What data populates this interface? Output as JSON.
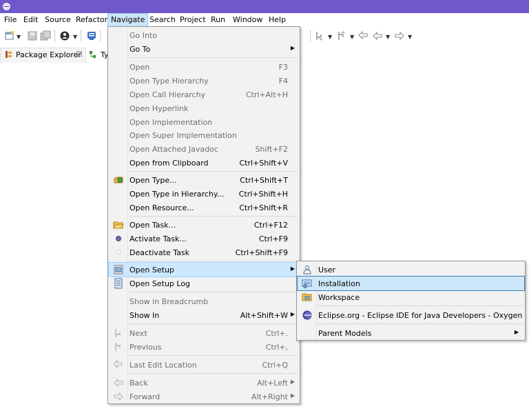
{
  "menubar": {
    "items": [
      "File",
      "Edit",
      "Source",
      "Refactor",
      "Navigate",
      "Search",
      "Project",
      "Run",
      "Window",
      "Help"
    ],
    "active": "Navigate"
  },
  "tabs": {
    "package_explorer": "Package Explorer",
    "close_glyph": "☒",
    "second_tab_partial": "Ty"
  },
  "navigate_menu": {
    "go_into": "Go Into",
    "go_to": "Go To",
    "open": {
      "label": "Open",
      "shortcut": "F3"
    },
    "open_type_hierarchy": {
      "label": "Open Type Hierarchy",
      "shortcut": "F4"
    },
    "open_call_hierarchy": {
      "label": "Open Call Hierarchy",
      "shortcut": "Ctrl+Alt+H"
    },
    "open_hyperlink": "Open Hyperlink",
    "open_implementation": "Open Implementation",
    "open_super_implementation": "Open Super Implementation",
    "open_attached_javadoc": {
      "label": "Open Attached Javadoc",
      "shortcut": "Shift+F2"
    },
    "open_from_clipboard": {
      "label": "Open from Clipboard",
      "shortcut": "Ctrl+Shift+V"
    },
    "open_type": {
      "label": "Open Type...",
      "shortcut": "Ctrl+Shift+T"
    },
    "open_type_in_hierarchy": {
      "label": "Open Type in Hierarchy...",
      "shortcut": "Ctrl+Shift+H"
    },
    "open_resource": {
      "label": "Open Resource...",
      "shortcut": "Ctrl+Shift+R"
    },
    "open_task": {
      "label": "Open Task...",
      "shortcut": "Ctrl+F12"
    },
    "activate_task": {
      "label": "Activate Task...",
      "shortcut": "Ctrl+F9"
    },
    "deactivate_task": {
      "label": "Deactivate Task",
      "shortcut": "Ctrl+Shift+F9"
    },
    "open_setup": "Open Setup",
    "open_setup_log": "Open Setup Log",
    "show_in_breadcrumb": "Show in Breadcrumb",
    "show_in": {
      "label": "Show In",
      "shortcut": "Alt+Shift+W"
    },
    "next": {
      "label": "Next",
      "shortcut": "Ctrl+."
    },
    "previous": {
      "label": "Previous",
      "shortcut": "Ctrl+,"
    },
    "last_edit_location": {
      "label": "Last Edit Location",
      "shortcut": "Ctrl+Q"
    },
    "back": {
      "label": "Back",
      "shortcut": "Alt+Left"
    },
    "forward": {
      "label": "Forward",
      "shortcut": "Alt+Right"
    }
  },
  "open_setup_submenu": {
    "user": "User",
    "installation": "Installation",
    "workspace": "Workspace",
    "eclipse_org": "Eclipse.org - Eclipse IDE for Java Developers - Oxygen",
    "parent_models": "Parent Models"
  },
  "glyphs": {
    "submenu_arrow": "▶"
  },
  "colors": {
    "titlebar": "#6f58c9",
    "highlight": "#cce8ff",
    "menu_bg": "#f2f2f2",
    "disabled_text": "#6d6d6d"
  }
}
